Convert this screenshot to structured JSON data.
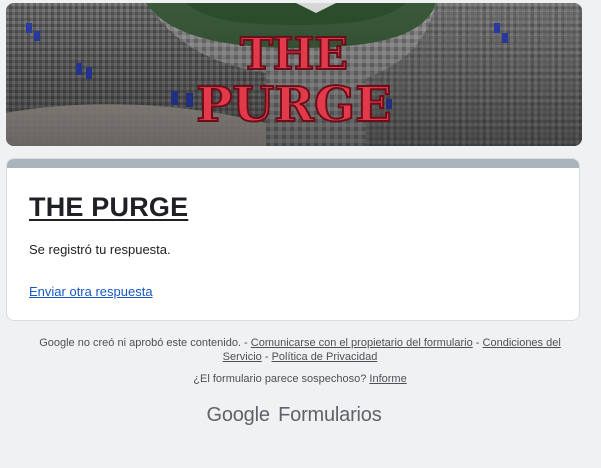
{
  "banner": {
    "text": "THE PURGE"
  },
  "form": {
    "title": "THE PURGE",
    "confirmation": "Se registró tu respuesta.",
    "resubmit_link": "Enviar otra respuesta"
  },
  "footer": {
    "disclaimer": "Google no creó ni aprobó este contenido. - ",
    "contact_owner": "Comunicarse con el propietario del formulario",
    "sep1": " - ",
    "terms": "Condiciones del Servicio",
    "sep2": " - ",
    "privacy": "Política de Privacidad",
    "suspicious": "¿El formulario parece sospechoso? ",
    "report": "Informe"
  },
  "brand": {
    "google": "Google",
    "product": "Formularios"
  },
  "colors": {
    "accent_bar": "#a9b3bc",
    "link": "#1a58c4",
    "banner_title": "#e03545"
  }
}
